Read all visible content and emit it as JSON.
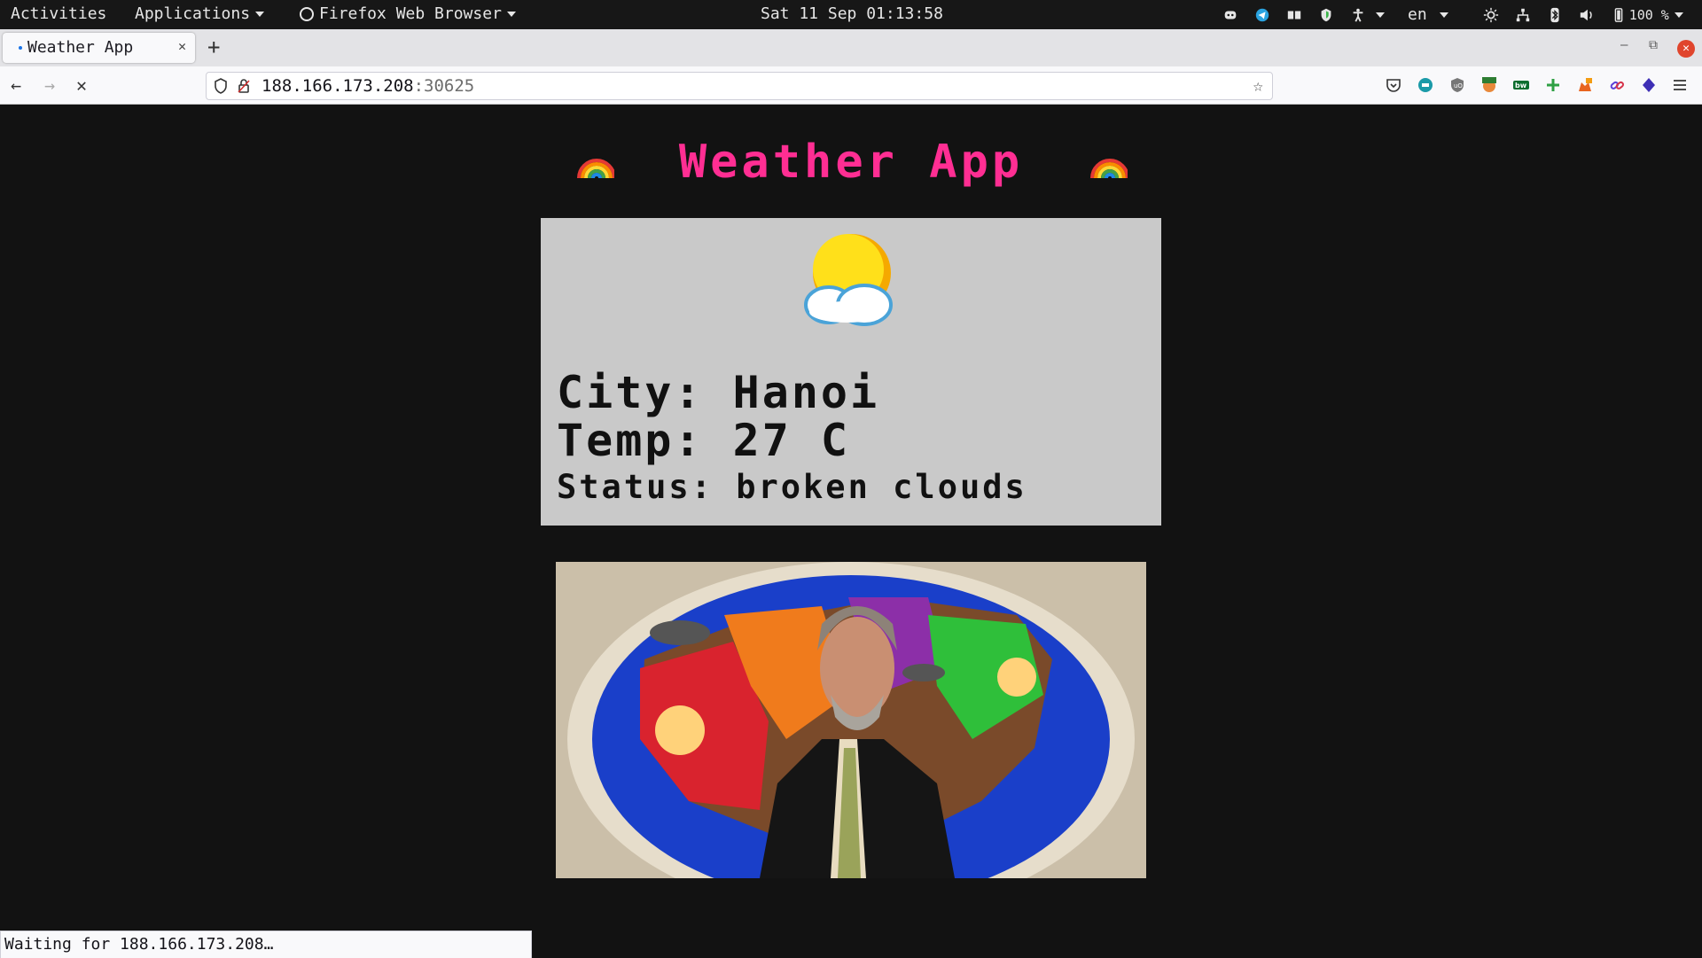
{
  "topbar": {
    "activities": "Activities",
    "applications": "Applications",
    "browser": "Firefox Web Browser",
    "clock": "Sat 11 Sep 01:13:58",
    "lang": "en",
    "battery": "100 %"
  },
  "browser": {
    "tab_title": "Weather App",
    "url_host": "188.166.173.208",
    "url_port": ":30625",
    "status_text": "Waiting for 188.166.173.208…"
  },
  "page": {
    "heading": "Weather App",
    "city_line": "City: Hanoi",
    "temp_line": "Temp: 27 C",
    "status_line": "Status: broken clouds"
  },
  "colors": {
    "page_bg": "#121212",
    "title_pink": "#ff2e93",
    "card_bg": "#c9c9c9"
  },
  "icons": {
    "weather": "sun-behind-cloud-icon",
    "heading_decor": "rainbow-icon"
  }
}
